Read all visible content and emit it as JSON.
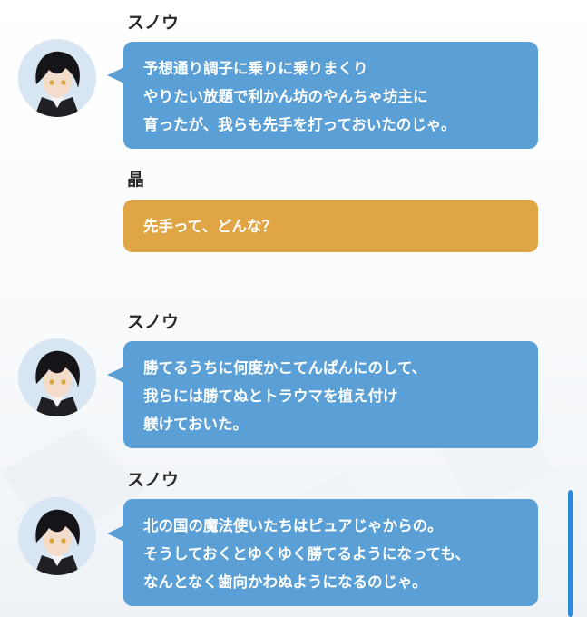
{
  "messages": [
    {
      "speaker": "スノウ",
      "lines": [
        "予想通り調子に乗りに乗りまくり",
        "やりたい放題で利かん坊のやんちゃ坊主に",
        "育ったが、我らも先手を打っておいたのじゃ。"
      ]
    },
    {
      "speaker": "晶",
      "lines": [
        "先手って、どんな？"
      ]
    },
    {
      "speaker": "スノウ",
      "lines": [
        "勝てるうちに何度かこてんぱんにのして、",
        "我らには勝てぬとトラウマを植え付け",
        "躾けておいた。"
      ]
    },
    {
      "speaker": "スノウ",
      "lines": [
        "北の国の魔法使いたちはピュアじゃからの。",
        "そうしておくとゆくゆく勝てるようになっても、",
        "なんとなく歯向かわぬようになるのじゃ。"
      ]
    }
  ],
  "colors": {
    "bubble_blue": "#5aa0d6",
    "bubble_orange": "#e0a645",
    "scrollbar": "#2e89d8",
    "avatar_bg": "#d7e6f2"
  },
  "icons": [
    "character-avatar-icon"
  ]
}
